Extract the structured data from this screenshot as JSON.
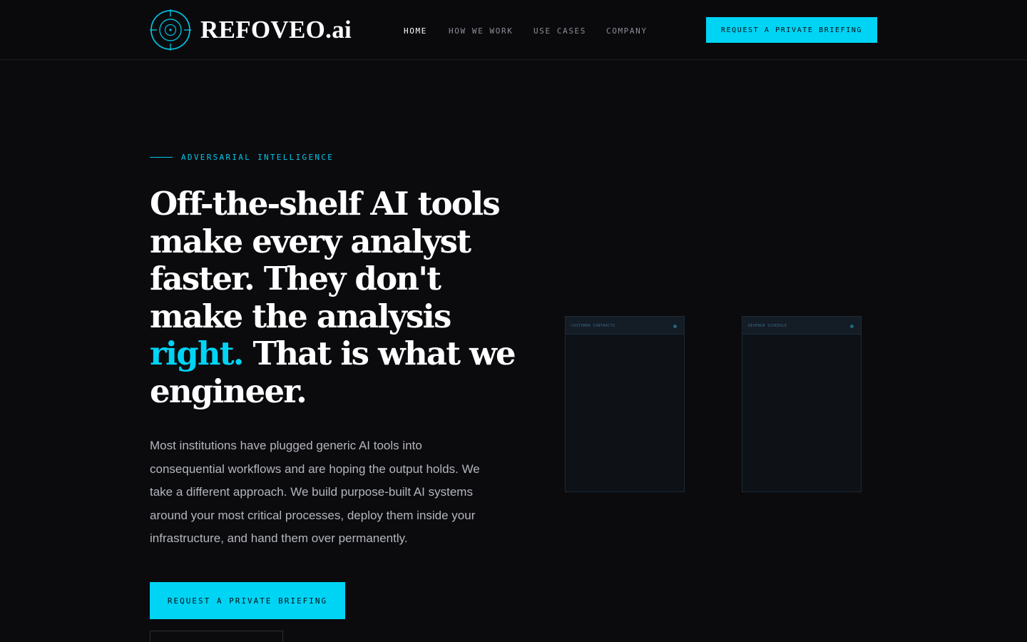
{
  "brand": {
    "name": "REFOVEO.ai",
    "accent_color": "#00d4f5",
    "logo_icon": "crosshair-target-icon"
  },
  "nav": {
    "items": [
      {
        "label": "HOME",
        "active": true
      },
      {
        "label": "HOW WE WORK",
        "active": false
      },
      {
        "label": "USE CASES",
        "active": false
      },
      {
        "label": "COMPANY",
        "active": false
      }
    ],
    "cta_label": "REQUEST A PRIVATE BRIEFING"
  },
  "hero": {
    "eyebrow": "ADVERSARIAL INTELLIGENCE",
    "headline": {
      "line1": "Off-the-shelf AI tools",
      "line2": "make every analyst",
      "line3": "faster. They don't",
      "line4": "make the analysis",
      "line5_accent": "right.",
      "line5_rest": " That is what we",
      "line6": "engineer."
    },
    "body": {
      "line1": "Most institutions have plugged generic AI tools into",
      "line2": "consequential workflows and are hoping the output holds. We",
      "line3": "take a different approach. We build purpose-built AI systems",
      "line4": "around your most critical processes, deploy them inside your",
      "line5": "infrastructure, and hand them over permanently."
    },
    "cta_label": "REQUEST A PRIVATE BRIEFING"
  },
  "panels": [
    {
      "title": "CUSTOMER CONTRACTS"
    },
    {
      "title": "REVENUE SCHEDULE"
    }
  ]
}
